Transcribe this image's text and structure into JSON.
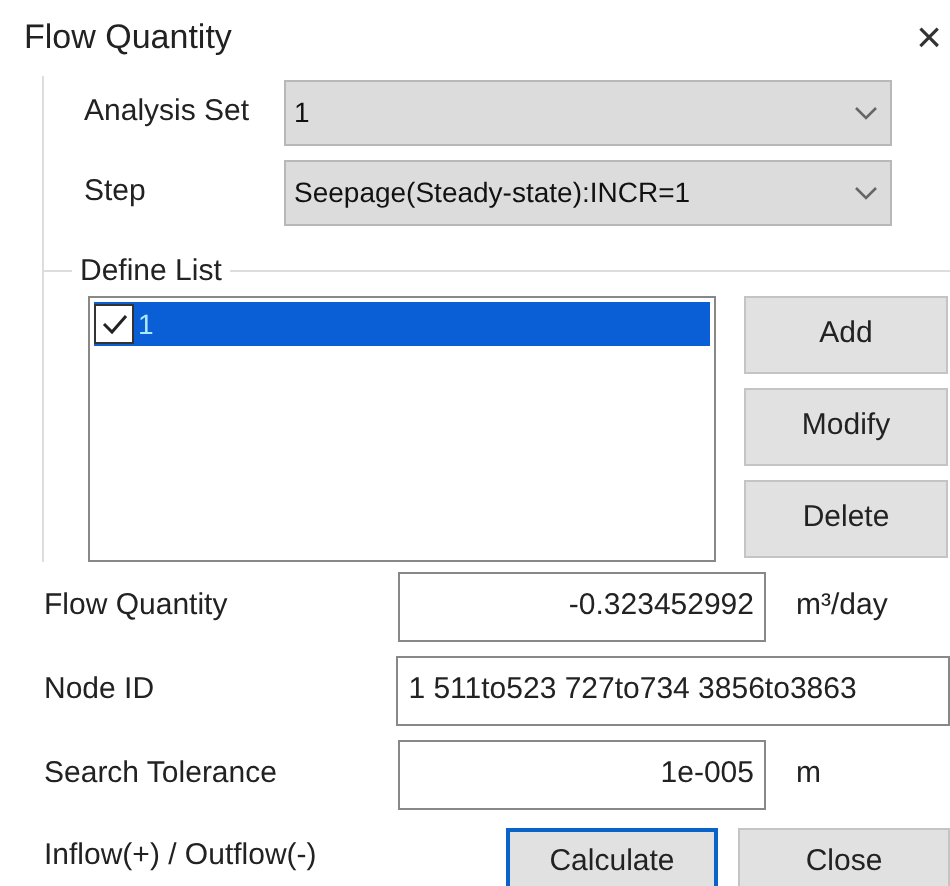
{
  "window": {
    "title": "Flow Quantity",
    "close": "×"
  },
  "analysis_set": {
    "label": "Analysis Set",
    "value": "1"
  },
  "step": {
    "label": "Step",
    "value": "Seepage(Steady-state):INCR=1"
  },
  "define_list": {
    "title": "Define List",
    "items": [
      {
        "label": "1",
        "checked": true,
        "selected": true
      }
    ],
    "buttons": [
      "Add",
      "Modify",
      "Delete"
    ]
  },
  "fields": [
    {
      "label": "Flow Quantity",
      "value": "-0.323452992",
      "unit": "m³/day"
    },
    {
      "label": "Node ID",
      "value": "1 511to523 727to734 3856to3863"
    },
    {
      "label": "Search Tolerance",
      "value": "1e-005",
      "unit": "m"
    }
  ],
  "note": "Inflow(+) / Outflow(-)",
  "buttons": [
    {
      "label": "Calculate",
      "focused": true
    },
    {
      "label": "Close",
      "focused": false
    }
  ]
}
